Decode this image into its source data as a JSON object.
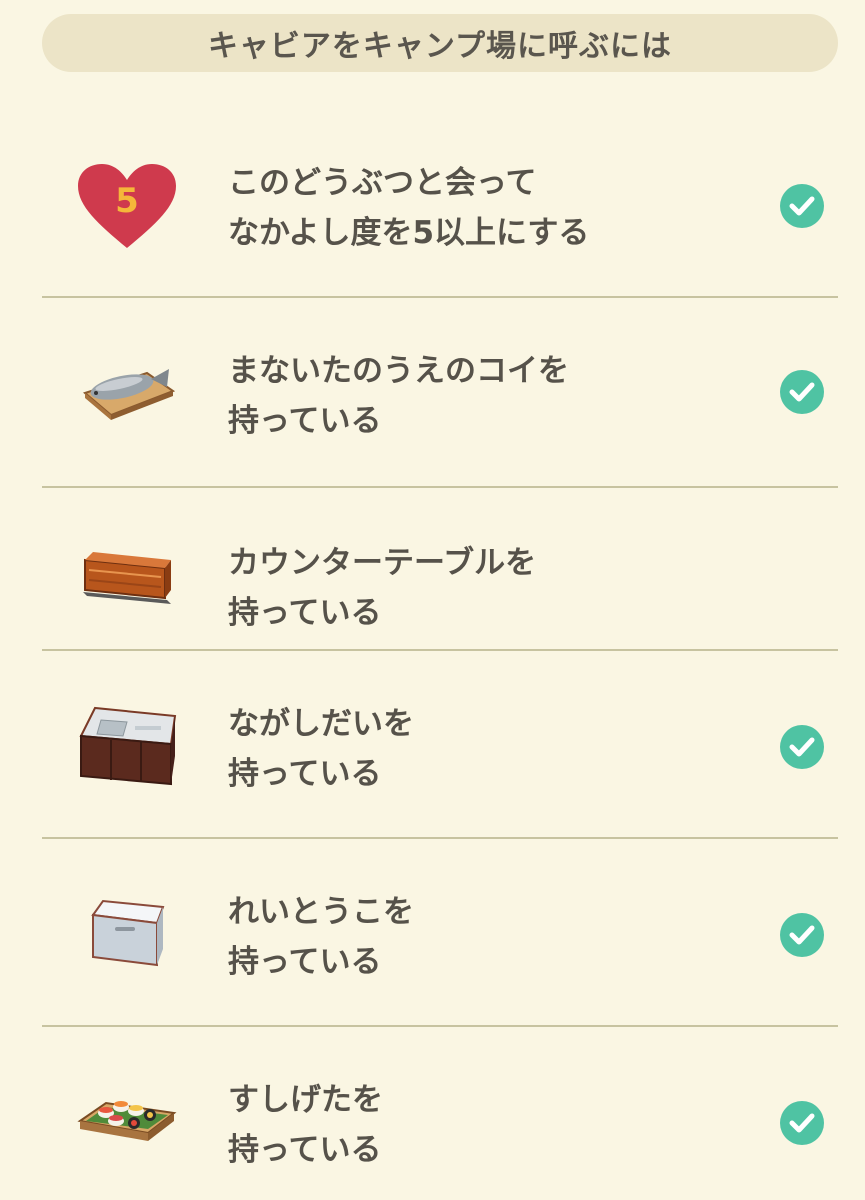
{
  "header": {
    "title": "キャビアをキャンプ場に呼ぶには"
  },
  "conditions": [
    {
      "icon": "heart-icon",
      "icon_number": "5",
      "line1": "このどうぶつと会って",
      "line2": "なかよし度を5以上にする",
      "completed": true
    },
    {
      "icon": "carp-on-cutting-board-icon",
      "line1": "まないたのうえのコイを",
      "line2": "持っている",
      "completed": true
    },
    {
      "icon": "counter-table-icon",
      "line1": "カウンターテーブルを",
      "line2": "持っている",
      "completed": false
    },
    {
      "icon": "kitchen-sink-icon",
      "line1": "ながしだいを",
      "line2": "持っている",
      "completed": true
    },
    {
      "icon": "refrigerator-icon",
      "line1": "れいとうこを",
      "line2": "持っている",
      "completed": true
    },
    {
      "icon": "sushi-platter-icon",
      "line1": "すしげたを",
      "line2": "持っている",
      "completed": true
    }
  ],
  "colors": {
    "background": "#faf6e3",
    "header_bg": "#ece4c7",
    "text": "#56524a",
    "divider": "#c7c3a0",
    "check": "#4fc3a3",
    "heart": "#cf3a4d",
    "heart_number": "#f5b73a"
  }
}
